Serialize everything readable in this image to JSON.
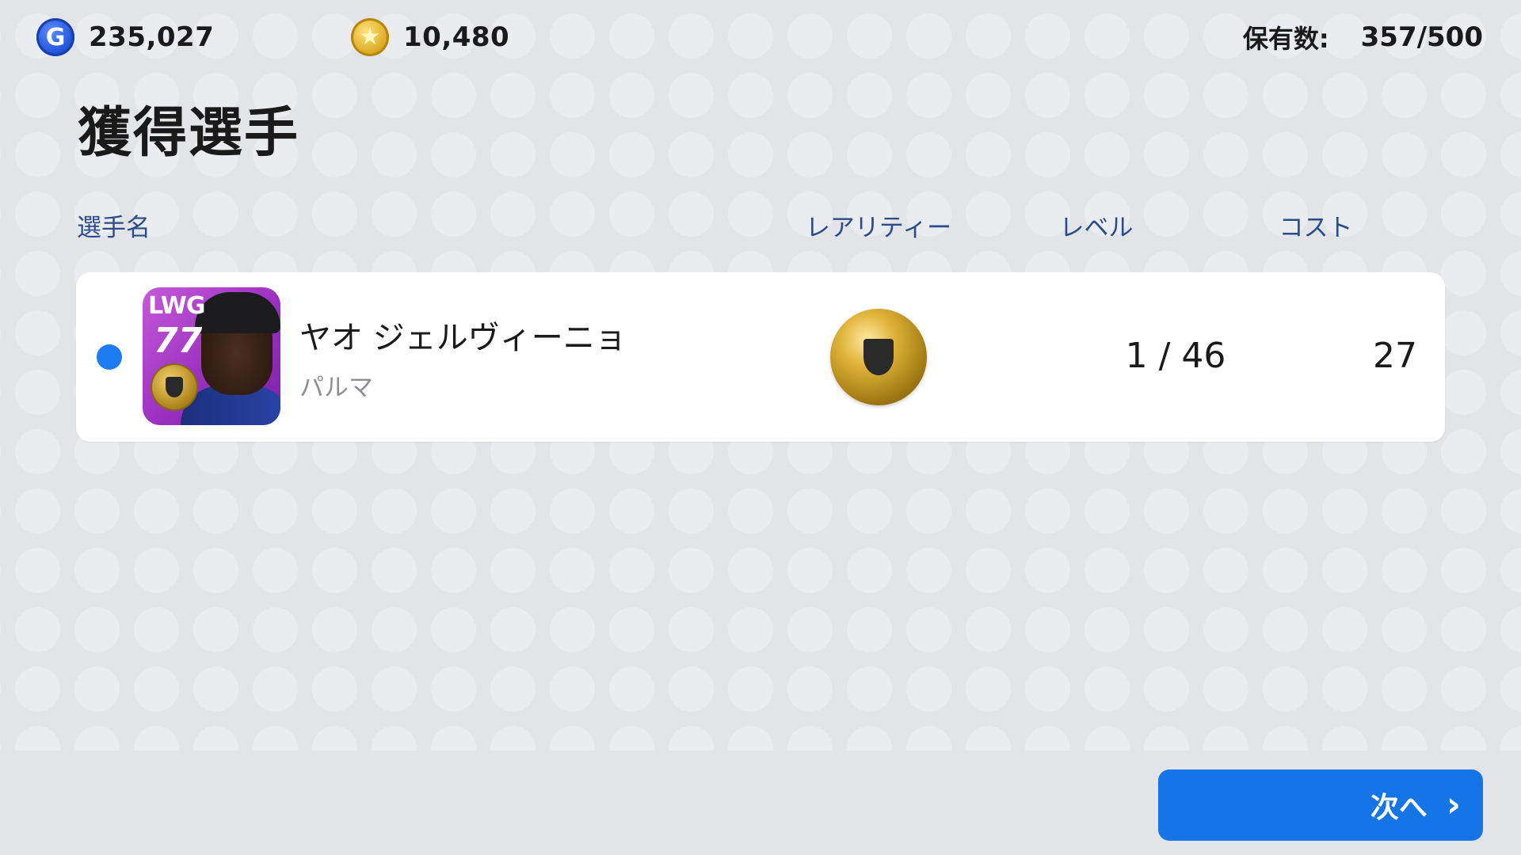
{
  "top_bar": {
    "gp_icon_glyph": "G",
    "gp_amount": "235,027",
    "coin_icon_glyph": "★",
    "coin_amount": "10,480",
    "capacity_label": "保有数:",
    "capacity_value": "357/500"
  },
  "page_title": "獲得選手",
  "table": {
    "headers": {
      "name": "選手名",
      "rarity": "レアリティー",
      "level": "レベル",
      "cost": "コスト"
    },
    "rows": [
      {
        "position": "LWG",
        "rating": "77",
        "name": "ヤオ ジェルヴィーニョ",
        "club": "パルマ",
        "rarity_icon": "gold-ball",
        "level": "1 / 46",
        "cost": "27"
      }
    ]
  },
  "next_button": {
    "label": "次へ",
    "arrow": "›"
  },
  "colors": {
    "accent": "#1575e6",
    "new_dot": "#1e7cf2",
    "header_text": "#2b4c8a",
    "card_purple": "#9a2fc0"
  },
  "icons": {
    "gp": "gp-currency-icon",
    "coin": "coin-currency-icon",
    "arrow": "chevron-right-icon"
  }
}
